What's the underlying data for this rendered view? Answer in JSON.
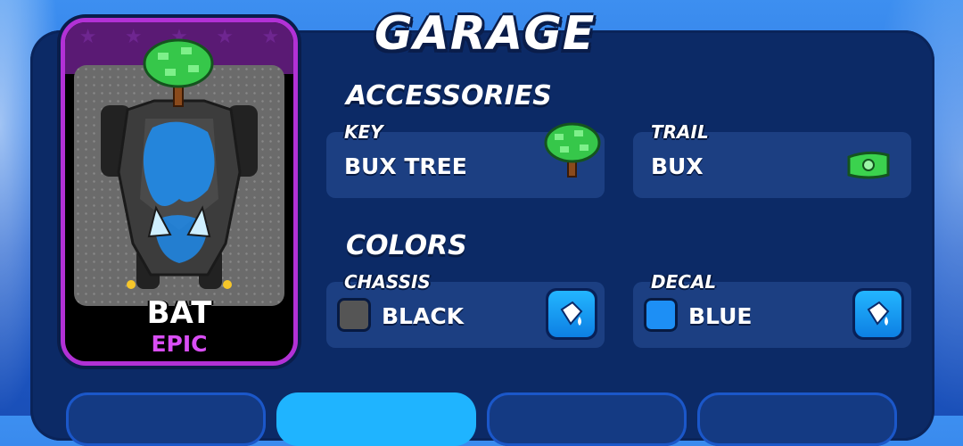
{
  "screen_title": "GARAGE",
  "car_card": {
    "name": "BAT",
    "rarity": "EPIC",
    "rarity_color": "#d94ef4",
    "frame_color": "#b231d6",
    "decoration_icon": "money-tree-icon"
  },
  "accessories": {
    "heading": "ACCESSORIES",
    "slots": [
      {
        "label": "KEY",
        "value": "BUX TREE",
        "icon": "money-tree-icon"
      },
      {
        "label": "TRAIL",
        "value": "BUX",
        "icon": "cash-bill-icon"
      }
    ]
  },
  "colors": {
    "heading": "COLORS",
    "slots": [
      {
        "label": "CHASSIS",
        "value": "BLACK",
        "swatch": "#555555",
        "button_icon": "paint-bucket-icon"
      },
      {
        "label": "DECAL",
        "value": "BLUE",
        "swatch": "#1d8ff5",
        "button_icon": "paint-bucket-icon"
      }
    ]
  },
  "bottom_tabs": {
    "count": 4,
    "active_index": 1
  },
  "theme": {
    "background": "#2f7be6",
    "panel": "#0c2a66",
    "slot": "#1c3f82",
    "accent": "#1fb4ff"
  }
}
